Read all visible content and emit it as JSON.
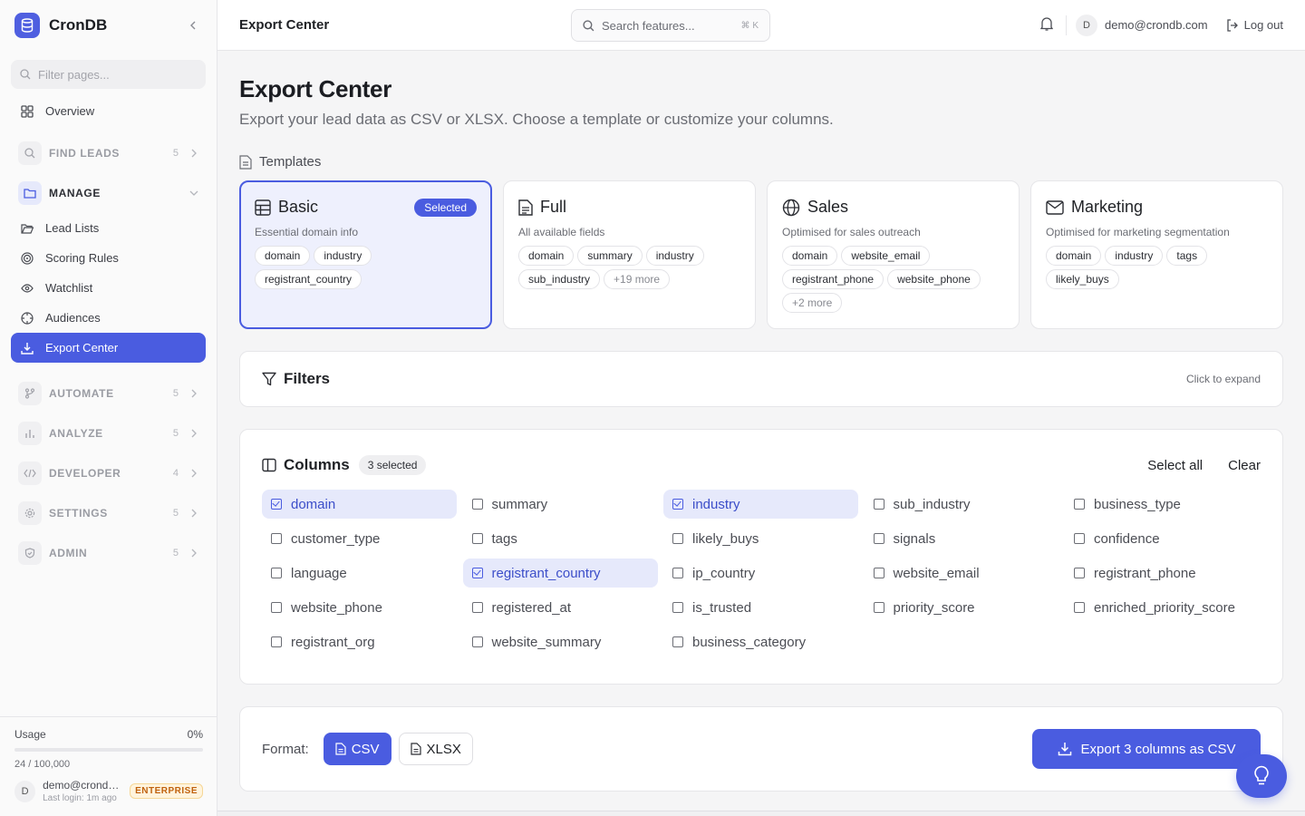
{
  "app": {
    "name": "CronDB"
  },
  "sidebar": {
    "filter_placeholder": "Filter pages...",
    "overview": "Overview",
    "sections": [
      {
        "label": "FIND LEADS",
        "count": "5"
      },
      {
        "label": "MANAGE"
      },
      {
        "label": "AUTOMATE",
        "count": "5"
      },
      {
        "label": "ANALYZE",
        "count": "5"
      },
      {
        "label": "DEVELOPER",
        "count": "4"
      },
      {
        "label": "SETTINGS",
        "count": "5"
      },
      {
        "label": "ADMIN",
        "count": "5"
      }
    ],
    "manage_items": [
      "Lead Lists",
      "Scoring Rules",
      "Watchlist",
      "Audiences",
      "Export Center"
    ],
    "active_item": "Export Center"
  },
  "usage": {
    "label": "Usage",
    "percent_text": "0%",
    "fraction": 0.0,
    "count_text": "24 / 100,000",
    "user_email": "demo@crondb.com",
    "last_login": "Last login: 1m ago",
    "plan": "ENTERPRISE",
    "avatar_initial": "D"
  },
  "topbar": {
    "title": "Export Center",
    "search_placeholder": "Search features...",
    "shortcut": "⌘ K",
    "user_initial": "D",
    "user_email": "demo@crondb.com",
    "logout": "Log out"
  },
  "page": {
    "title": "Export Center",
    "subtitle": "Export your lead data as CSV or XLSX. Choose a template or customize your columns."
  },
  "templates": {
    "heading": "Templates",
    "selected_badge": "Selected",
    "items": [
      {
        "name": "Basic",
        "icon": "table-icon",
        "desc": "Essential domain info",
        "tags": [
          "domain",
          "industry",
          "registrant_country"
        ],
        "selected": true
      },
      {
        "name": "Full",
        "icon": "document-icon",
        "desc": "All available fields",
        "tags": [
          "domain",
          "summary",
          "industry",
          "sub_industry",
          "+19 more"
        ]
      },
      {
        "name": "Sales",
        "icon": "globe-icon",
        "desc": "Optimised for sales outreach",
        "tags": [
          "domain",
          "website_email",
          "registrant_phone",
          "website_phone",
          "+2 more"
        ]
      },
      {
        "name": "Marketing",
        "icon": "mail-icon",
        "desc": "Optimised for marketing segmentation",
        "tags": [
          "domain",
          "industry",
          "tags",
          "likely_buys"
        ]
      }
    ]
  },
  "filters": {
    "label": "Filters",
    "hint": "Click to expand"
  },
  "columns": {
    "label": "Columns",
    "selected_count": "3 selected",
    "select_all": "Select all",
    "clear": "Clear",
    "options": [
      {
        "name": "domain",
        "checked": true
      },
      {
        "name": "summary",
        "checked": false
      },
      {
        "name": "industry",
        "checked": true
      },
      {
        "name": "sub_industry",
        "checked": false
      },
      {
        "name": "business_type",
        "checked": false
      },
      {
        "name": "customer_type",
        "checked": false
      },
      {
        "name": "tags",
        "checked": false
      },
      {
        "name": "likely_buys",
        "checked": false
      },
      {
        "name": "signals",
        "checked": false
      },
      {
        "name": "confidence",
        "checked": false
      },
      {
        "name": "language",
        "checked": false
      },
      {
        "name": "registrant_country",
        "checked": true
      },
      {
        "name": "ip_country",
        "checked": false
      },
      {
        "name": "website_email",
        "checked": false
      },
      {
        "name": "registrant_phone",
        "checked": false
      },
      {
        "name": "website_phone",
        "checked": false
      },
      {
        "name": "registered_at",
        "checked": false
      },
      {
        "name": "is_trusted",
        "checked": false
      },
      {
        "name": "priority_score",
        "checked": false
      },
      {
        "name": "enriched_priority_score",
        "checked": false
      },
      {
        "name": "registrant_org",
        "checked": false
      },
      {
        "name": "website_summary",
        "checked": false
      },
      {
        "name": "business_category",
        "checked": false
      }
    ]
  },
  "export": {
    "format_label": "Format:",
    "formats": [
      "CSV",
      "XLSX"
    ],
    "selected_format": "CSV",
    "button": "Export 3 columns as CSV"
  },
  "colors": {
    "accent": "#4a5ce0",
    "accent_light": "#e6e9fb"
  }
}
